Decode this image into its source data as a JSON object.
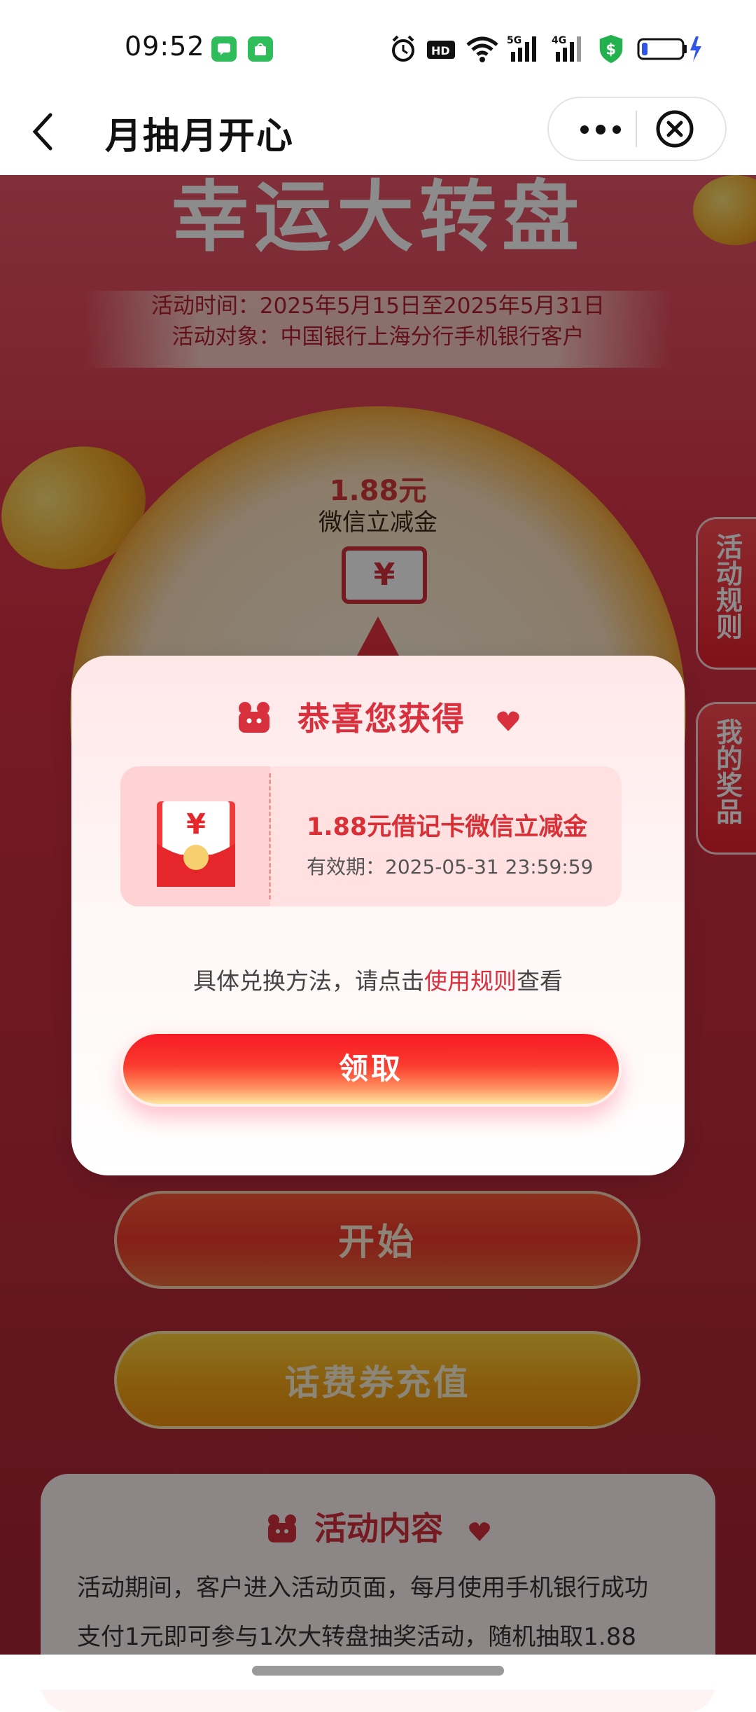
{
  "status_bar": {
    "time": "09:52"
  },
  "header": {
    "title": "月抽月开心"
  },
  "banner": {
    "title": "幸运大转盘",
    "activity_time": "活动时间：2025年5月15日至2025年5月31日",
    "activity_target": "活动对象：中国银行上海分行手机银行客户"
  },
  "wheel": {
    "amount": "1.88元",
    "prize_type": "微信立减金",
    "coupon_symbol": "¥"
  },
  "side_tabs": {
    "rules": "活动规则",
    "my_prizes": "我的奖品"
  },
  "buttons": {
    "start": "开始",
    "recharge": "话费券充值"
  },
  "content": {
    "title": "活动内容",
    "line1": "活动期间，客户进入活动页面，每月使用手机银行成功",
    "line2": "支付1元即可参与1次大转盘抽奖活动，随机抽取1.88"
  },
  "dialog": {
    "title": "恭喜您获得",
    "prize_name": "1.88元借记卡微信立减金",
    "validity": "有效期：2025-05-31 23:59:59",
    "hint_prefix": "具体兑换方法，请点击",
    "hint_link": "使用规则",
    "hint_suffix": "查看",
    "claim_button": "领取",
    "envelope_symbol": "¥"
  },
  "colors": {
    "brand_red": "#d8303d",
    "accent_orange": "#f7a515"
  }
}
